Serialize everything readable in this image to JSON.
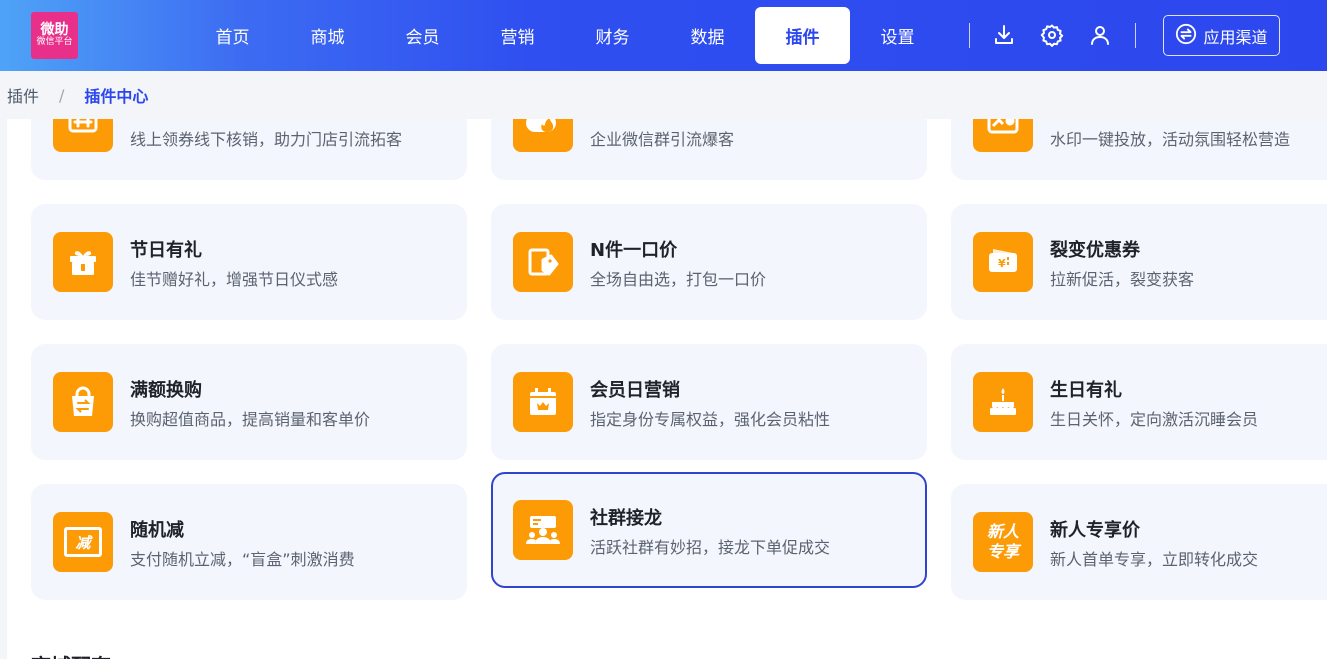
{
  "logo": {
    "line1": "微助",
    "line2": "微信平台"
  },
  "nav": {
    "items": [
      {
        "label": "首页",
        "active": false
      },
      {
        "label": "商城",
        "active": false
      },
      {
        "label": "会员",
        "active": false
      },
      {
        "label": "营销",
        "active": false
      },
      {
        "label": "财务",
        "active": false
      },
      {
        "label": "数据",
        "active": false
      },
      {
        "label": "插件",
        "active": true
      },
      {
        "label": "设置",
        "active": false
      }
    ],
    "tools": [
      "download-icon",
      "gear-icon",
      "user-icon"
    ],
    "channel_label": "应用渠道"
  },
  "breadcrumb": {
    "root": "插件",
    "separator": "/",
    "current": "插件中心"
  },
  "cards": [
    {
      "title": "",
      "desc": "线上领券线下核销，助力门店引流拓客",
      "icon": "coupon-icon"
    },
    {
      "title": "",
      "desc": "企业微信群引流爆客",
      "icon": "fire-chat-icon"
    },
    {
      "title": "",
      "desc": "水印一键投放，活动氛围轻松营造",
      "icon": "watermark-icon"
    },
    {
      "title": "节日有礼",
      "desc": "佳节赠好礼，增强节日仪式感",
      "icon": "gift-icon"
    },
    {
      "title": "N件一口价",
      "desc": "全场自由选，打包一口价",
      "icon": "price-tag-icon"
    },
    {
      "title": "裂变优惠券",
      "desc": "拉新促活，裂变获客",
      "icon": "yen-coupon-icon"
    },
    {
      "title": "满额换购",
      "desc": "换购超值商品，提高销量和客单价",
      "icon": "shopping-bag-exchange-icon"
    },
    {
      "title": "会员日营销",
      "desc": "指定身份专属权益，强化会员粘性",
      "icon": "calendar-crown-icon"
    },
    {
      "title": "生日有礼",
      "desc": "生日关怀，定向激活沉睡会员",
      "icon": "birthday-cake-icon"
    },
    {
      "title": "随机减",
      "desc": "支付随机立减，“盲盒”刺激消费",
      "icon": "random-discount-icon",
      "icon_text": "减"
    },
    {
      "title": "社群接龙",
      "desc": "活跃社群有妙招，接龙下单促成交",
      "icon": "community-group-icon",
      "selected": true
    },
    {
      "title": "新人专享价",
      "desc": "新人首单专享，立即转化成交",
      "icon": "new-user-icon",
      "icon_text": "新人专享"
    }
  ],
  "section": {
    "title": "商城配套"
  },
  "colors": {
    "primary": "#2c47ee",
    "accent": "#fd9b06",
    "card_bg": "#f3f6fc"
  }
}
